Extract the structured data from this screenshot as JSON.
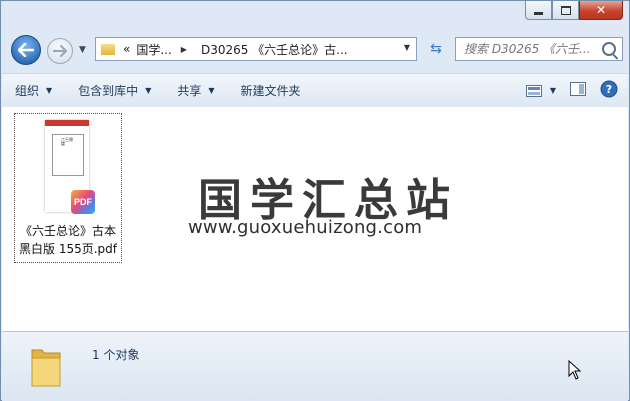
{
  "window": {
    "controls": {
      "minimize": "minimize",
      "maximize": "maximize",
      "close": "close"
    }
  },
  "address": {
    "overflow": "«",
    "segments": [
      "国学...",
      "D30265 《六壬总论》古..."
    ]
  },
  "search": {
    "placeholder": "搜索 D30265 《六壬..."
  },
  "toolbar": {
    "organize": "组织",
    "include_in_library": "包含到库中",
    "share": "共享",
    "new_folder": "新建文件夹"
  },
  "files": [
    {
      "name_line1": "《六壬总论》古本",
      "name_line2": "黑白版 155页.pdf",
      "type_badge": "PDF",
      "thumb_title": "六壬總論"
    }
  ],
  "watermark": {
    "title": "国学汇总站",
    "url": "www.guoxuehuizong.com"
  },
  "status": {
    "text": "1 个对象"
  },
  "colors": {
    "window_frame": "#dfe9f5",
    "toolbar_text": "#1e3a5f",
    "back_button": "#2f6fba",
    "close_button": "#c7452f"
  }
}
